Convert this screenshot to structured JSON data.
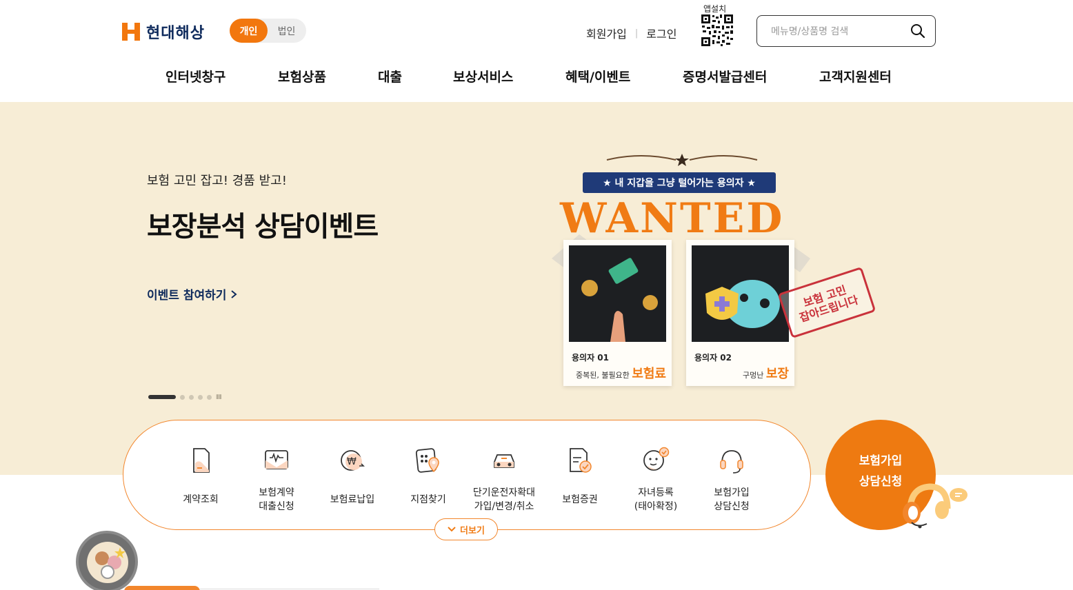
{
  "header": {
    "brand": "현대해상",
    "segment": {
      "options": [
        "개인",
        "법인"
      ],
      "selected": "개인"
    },
    "links": {
      "signup": "회원가입",
      "login": "로그인"
    },
    "app_install_label": "앱설치",
    "search_placeholder": "메뉴명/상품명 검색"
  },
  "gnb": [
    "인터넷창구",
    "보험상품",
    "대출",
    "보상서비스",
    "혜택/이벤트",
    "증명서발급센터",
    "고객지원센터"
  ],
  "banner": {
    "subtitle": "보험 고민 잡고! 경품 받고!",
    "title": "보장분석 상담이벤트",
    "cta": "이벤트 참여하기",
    "slide_count": 6,
    "active_slide": 1,
    "art": {
      "tagline": "★ 내 지갑을 그냥 털어가는 용의자 ★",
      "headline": "WANTED",
      "stamp_line1": "보험 고민",
      "stamp_line2": "잡아드립니다",
      "cards": [
        {
          "id": "용의자 01",
          "desc": "중복된, 불필요한",
          "emph": "보험료"
        },
        {
          "id": "용의자 02",
          "desc": "구멍난",
          "emph": "보장"
        }
      ]
    }
  },
  "quick_menu": {
    "items": [
      {
        "line1": "계약조회",
        "line2": "",
        "icon": "document-icon"
      },
      {
        "line1": "보험계약",
        "line2": "대출신청",
        "icon": "wallet-icon"
      },
      {
        "line1": "보험료납입",
        "line2": "",
        "icon": "won-payment-icon"
      },
      {
        "line1": "지점찾기",
        "line2": "",
        "icon": "map-pin-icon"
      },
      {
        "line1": "단기운전자확대",
        "line2": "가입/변경/취소",
        "icon": "car-icon"
      },
      {
        "line1": "보험증권",
        "line2": "",
        "icon": "certificate-icon"
      },
      {
        "line1": "자녀등록",
        "line2": "(태아확정)",
        "icon": "baby-icon"
      },
      {
        "line1": "보험가입",
        "line2": "상담신청",
        "icon": "headset-icon"
      }
    ],
    "more_label": "더보기"
  },
  "consult": {
    "line1": "보험가입",
    "line2": "상담신청"
  },
  "colors": {
    "accent": "#f07b14",
    "navy": "#0e2a5c",
    "banner_bg": "#f7edd6"
  }
}
